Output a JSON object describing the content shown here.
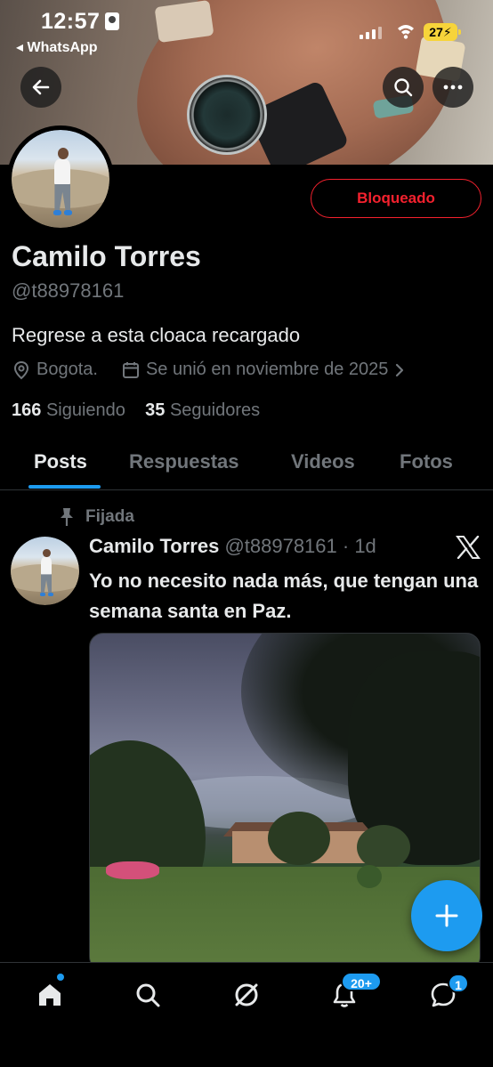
{
  "status_bar": {
    "time": "12:57",
    "back_app_label": "◂ WhatsApp",
    "battery": "27"
  },
  "header": {
    "blocked_label": "Bloqueado"
  },
  "profile": {
    "name": "Camilo Torres",
    "handle": "@t88978161",
    "bio": "Regrese a esta cloaca recargado",
    "location": "Bogota.",
    "joined": "Se unió en noviembre de 2025",
    "following_count": "166",
    "following_label": "Siguiendo",
    "followers_count": "35",
    "followers_label": "Seguidores"
  },
  "tabs": [
    {
      "label": "Posts",
      "active": true
    },
    {
      "label": "Respuestas",
      "active": false
    },
    {
      "label": "Videos",
      "active": false
    },
    {
      "label": "Fotos",
      "active": false
    }
  ],
  "post": {
    "pinned_label": "Fijada",
    "author_name": "Camilo Torres",
    "author_meta": "@t88978161 · 1d",
    "text": "Yo no necesito nada más, que tengan una semana santa en Paz."
  },
  "bottom_nav": {
    "notifications_badge": "20+",
    "messages_badge": "1"
  },
  "colors": {
    "accent": "#1d9bf0",
    "danger": "#f4212e",
    "muted": "#71767b",
    "text": "#e7e9ea",
    "background": "#000000",
    "battery": "#f7d43a"
  },
  "icons": [
    "back-arrow-icon",
    "search-icon",
    "more-icon",
    "location-icon",
    "calendar-icon",
    "chevron-right-icon",
    "pin-icon",
    "x-logo-icon",
    "plus-icon",
    "home-icon",
    "search-nav-icon",
    "grok-icon",
    "bell-icon",
    "messages-icon"
  ]
}
